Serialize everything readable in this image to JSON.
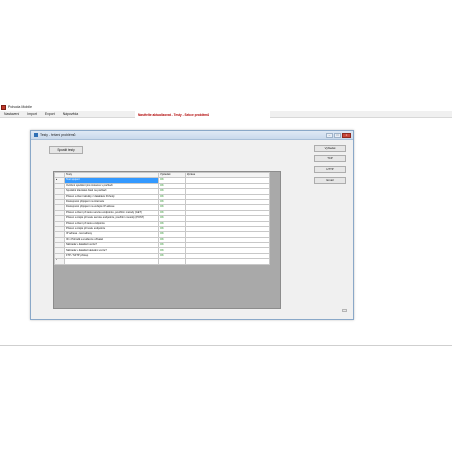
{
  "app": {
    "title": "Pohoda Mobile"
  },
  "menu": [
    {
      "label": "Nastavení"
    },
    {
      "label": "Import"
    },
    {
      "label": "Export"
    },
    {
      "label": "Nápověda"
    }
  ],
  "notice": "Nastřelte aktualizovat - Testy - Sekce problémů",
  "dialog": {
    "title": "Testy - řešení problémů",
    "run_button": "Spustit testy",
    "side_buttons": [
      "Vyhledat",
      "TCP",
      "HTTP",
      "Email"
    ],
    "columns": [
      "Testy",
      "Výsledek",
      "Zpráva"
    ],
    "rows": [
      {
        "test": "Test spojení",
        "result": "OK",
        "error": ""
      },
      {
        "test": "Ověření spuštění jiné instance v počítači",
        "result": "OK",
        "error": ""
      },
      {
        "test": "Spuštění klientské části na počítači",
        "result": "OK",
        "error": ""
      },
      {
        "test": "Přesun a čtení tabulky z databáze Pohody",
        "result": "OK",
        "error": ""
      },
      {
        "test": "Dostupnost připojení na internetu",
        "result": "OK",
        "error": ""
      },
      {
        "test": "Dostupnost připojení na veřejné IP adrese",
        "result": "OK",
        "error": ""
      },
      {
        "test": "Přesun a čtení při testu servisu endpointu, použitím metody (GET)",
        "result": "OK",
        "error": ""
      },
      {
        "test": "Přesun a zápis při testu servisu endpointu, použitím metody (POST)",
        "result": "OK",
        "error": ""
      },
      {
        "test": "Přesun a čtení při testu endpointu",
        "result": "OK",
        "error": ""
      },
      {
        "test": "Přesun a zápis při testu endpointu",
        "result": "OK",
        "error": ""
      },
      {
        "test": "IP adresa - test adresy",
        "result": "OK",
        "error": ""
      },
      {
        "test": "ID v Pohodě a evidence uživatel",
        "result": "OK",
        "error": ""
      },
      {
        "test": "Náhrada v databázi verze?",
        "result": "OK",
        "error": ""
      },
      {
        "test": "Náhrada v databázi aktuální verze?",
        "result": "OK",
        "error": ""
      },
      {
        "test": "FTP / SFTP přístup",
        "result": "OK",
        "error": ""
      },
      {
        "test": "",
        "result": "",
        "error": ""
      }
    ]
  }
}
